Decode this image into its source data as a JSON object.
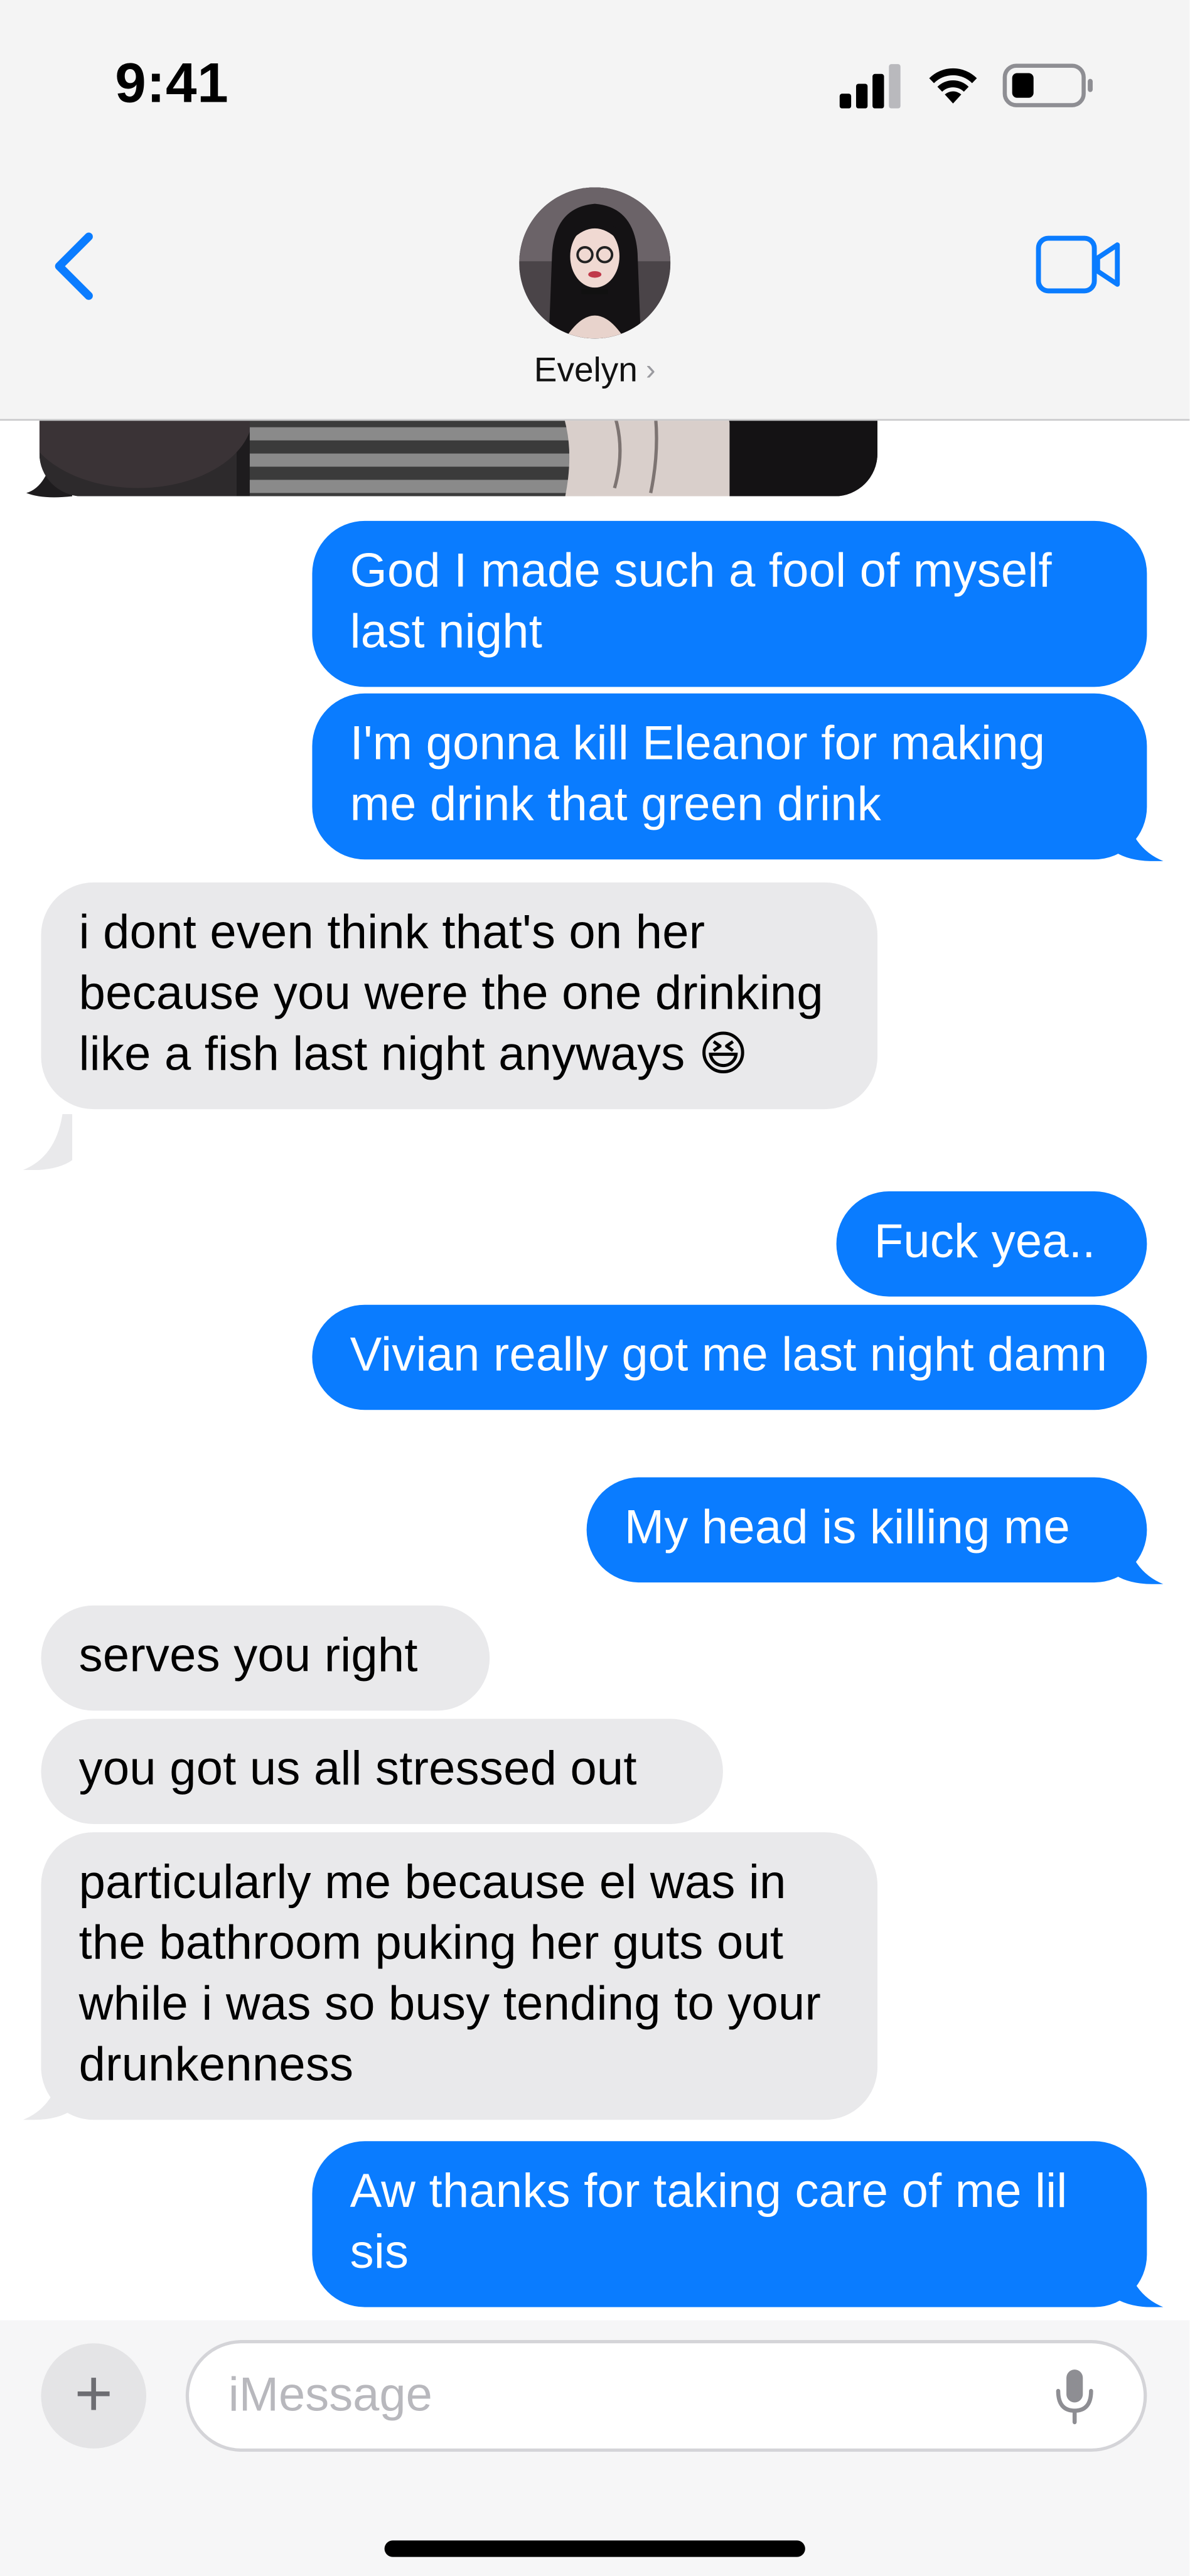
{
  "status_bar": {
    "time": "9:41"
  },
  "header": {
    "contact_name": "Evelyn",
    "chevron": "›",
    "back_icon": "chevron-left-icon",
    "video_icon": "video-camera-icon"
  },
  "colors": {
    "outgoing_bubble": "#0a7cff",
    "incoming_bubble": "#e9e9eb",
    "accent": "#0a7cff"
  },
  "messages": [
    {
      "direction": "out",
      "text": "God I made such a fool of myself last night"
    },
    {
      "direction": "out",
      "text": "I'm gonna kill Eleanor for making me drink that green drink"
    },
    {
      "direction": "in",
      "text": "i dont even think that's on her because you were the one drinking like a fish last night anyways 😆"
    },
    {
      "direction": "out",
      "text": "Fuck yea.."
    },
    {
      "direction": "out",
      "text": "Vivian really got me last night damn"
    },
    {
      "direction": "out",
      "text": "My head is killing me"
    },
    {
      "direction": "in",
      "text": "serves you right"
    },
    {
      "direction": "in",
      "text": "you got us all stressed out"
    },
    {
      "direction": "in",
      "text": "particularly me because el was in the bathroom puking her guts out while i was so busy tending to your drunkenness"
    },
    {
      "direction": "out",
      "text": "Aw thanks for taking care of me lil sis"
    }
  ],
  "composer": {
    "placeholder": "iMessage",
    "plus_label": "+"
  }
}
